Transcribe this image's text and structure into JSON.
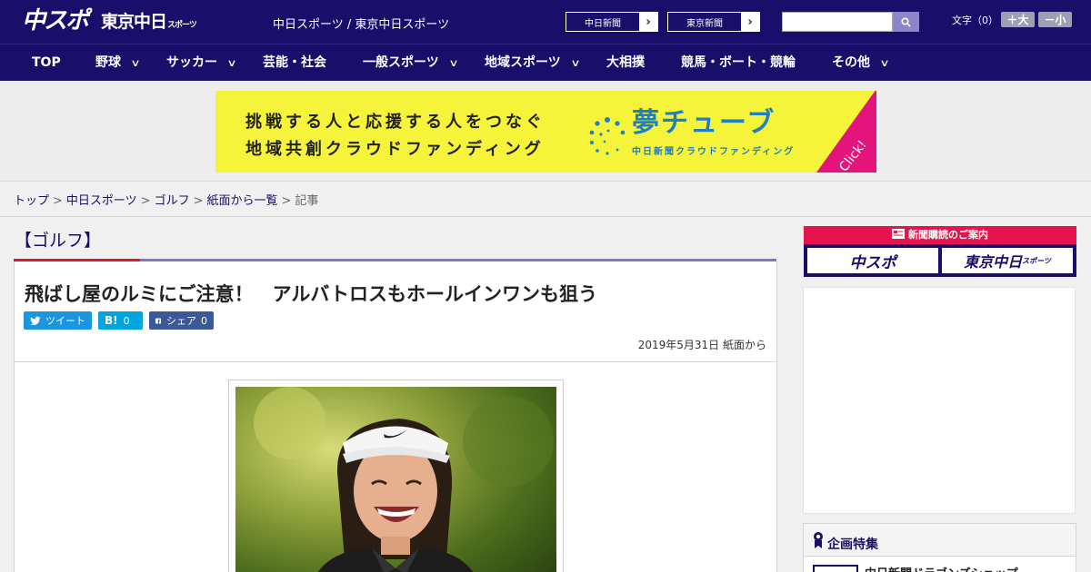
{
  "header": {
    "logo_main": "中スポ",
    "logo_tokyo": "東京中日",
    "logo_tokyo_small": "スポーツ",
    "site_title": "中日スポーツ / 東京中日スポーツ",
    "paper_links": [
      {
        "label": "中日新聞"
      },
      {
        "label": "東京新聞"
      }
    ],
    "search": {
      "placeholder": ""
    },
    "font_size": {
      "label": "文字（0）",
      "bigger": "＋大",
      "smaller": "－小"
    }
  },
  "nav": {
    "items": [
      {
        "label": "TOP",
        "has_menu": false
      },
      {
        "label": "野球",
        "has_menu": true
      },
      {
        "label": "サッカー",
        "has_menu": true
      },
      {
        "label": "芸能・社会",
        "has_menu": false
      },
      {
        "label": "一般スポーツ",
        "has_menu": true
      },
      {
        "label": "地域スポーツ",
        "has_menu": true
      },
      {
        "label": "大相撲",
        "has_menu": false
      },
      {
        "label": "競馬・ボート・競輪",
        "has_menu": false
      },
      {
        "label": "その他",
        "has_menu": true
      }
    ]
  },
  "banner": {
    "line1": "挑戦する人と応援する人をつなぐ",
    "line2": "地域共創クラウドファンディング",
    "brand": "夢チューブ",
    "brand_sub": "中日新聞クラウドファンディング",
    "click": "Click!",
    "colors": {
      "background": "#f6f33b",
      "brand": "#1d7fc4",
      "click": "#e5147d"
    }
  },
  "breadcrumb": {
    "items": [
      "トップ",
      "中日スポーツ",
      "ゴルフ",
      "紙面から一覧"
    ],
    "current": "記事",
    "separator": ">"
  },
  "article": {
    "category": "【ゴルフ】",
    "title": "飛ばし屋のルミにご注意！　アルバトロスもホールインワンも狙う",
    "share": {
      "tweet": "ツイート",
      "hatena_icon": "B!",
      "hatena_count": "0",
      "facebook": "シェア",
      "facebook_count": "0"
    },
    "date": "2019年5月31日 紙面から"
  },
  "sidebar": {
    "subscribe_head": "新聞購読のご案内",
    "subscribe_logos": [
      "中スポ",
      "東京中日"
    ],
    "subscribe_small": "スポーツ",
    "feature_title": "企画特集",
    "feature_item": "中日新聞ドラゴンズショップ"
  },
  "colors": {
    "navy": "#190e6a",
    "accent_red": "#d71b2a",
    "accent_purple": "#7f78bf",
    "twitter": "#1b95e0",
    "hatena": "#00a4de",
    "facebook": "#3b5998"
  }
}
